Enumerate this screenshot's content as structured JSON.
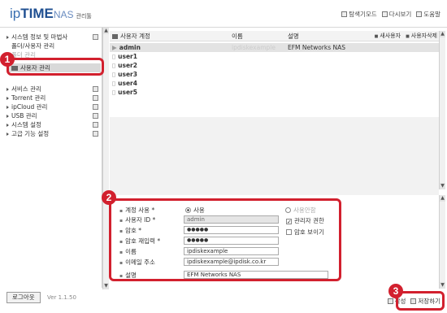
{
  "header": {
    "logo_prefix": "ip",
    "logo_main": "TIME",
    "logo_nas": "NAS",
    "logo_admin": "관리툴",
    "links": [
      "탐색기모드",
      "다시보기",
      "도움말"
    ]
  },
  "sidebar": {
    "items": [
      {
        "label": "시스템 정보 및 마법사",
        "level": 0
      },
      {
        "label": "폴더/사용자 관리",
        "level": 1
      },
      {
        "label": "폴더 관리",
        "level": 1
      },
      {
        "label": "사용자 관리",
        "level": 1
      },
      {
        "label": "서비스 관리",
        "level": 0
      },
      {
        "label": "Torrent 관리",
        "level": 0
      },
      {
        "label": "ipCloud 관리",
        "level": 0
      },
      {
        "label": "USB 관리",
        "level": 0
      },
      {
        "label": "시스템 설정",
        "level": 0
      },
      {
        "label": "고급 기능 설정",
        "level": 0
      }
    ],
    "logout": "로그아웃",
    "version": "Ver 1.1.50"
  },
  "user_list": {
    "headers": {
      "account": "사용자 계정",
      "name": "이름",
      "desc": "설명"
    },
    "actions": [
      "새사용자",
      "사용자삭제"
    ],
    "rows": [
      {
        "account": "admin",
        "name": "ipdiskexample",
        "desc": "EFM Networks NAS"
      },
      {
        "account": "user1",
        "name": "",
        "desc": ""
      },
      {
        "account": "user2",
        "name": "",
        "desc": ""
      },
      {
        "account": "user3",
        "name": "",
        "desc": ""
      },
      {
        "account": "user4",
        "name": "",
        "desc": ""
      },
      {
        "account": "user5",
        "name": "",
        "desc": ""
      }
    ]
  },
  "form": {
    "account_use_label": "계정 사용 *",
    "use_on": "사용",
    "use_off": "사용안함",
    "user_id_label": "사용자 ID *",
    "user_id_value": "admin",
    "admin_perm": "관리자 권한",
    "password_label": "암호 *",
    "password_value": "●●●●●",
    "show_password": "암호 보이기",
    "password_confirm_label": "암호 재입력 *",
    "password_confirm_value": "●●●●●",
    "name_label": "이름",
    "name_value": "ipdiskexample",
    "email_label": "이메일 주소",
    "email_value": "ipdiskexample@ipdisk.co.kr",
    "desc_label": "설명",
    "desc_value": "EFM Networks NAS"
  },
  "footer": {
    "write_label": "작성",
    "save_label": "저장하기"
  },
  "callouts": [
    "1",
    "2",
    "3"
  ],
  "colors": {
    "callout": "#d2202e",
    "brand": "#3a6fb0"
  }
}
